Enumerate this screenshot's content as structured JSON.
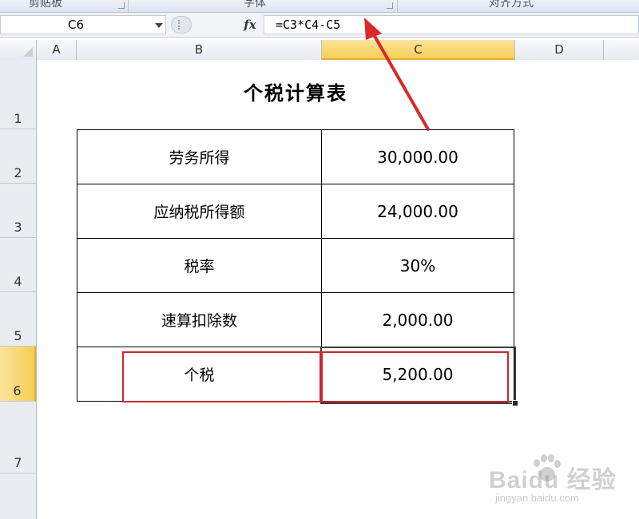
{
  "ribbon": {
    "groups": [
      "剪贴板",
      "字体",
      "对齐方式"
    ]
  },
  "formula_bar": {
    "name_box": "C6",
    "fx_label": "fx",
    "formula": "=C3*C4-C5"
  },
  "columns": [
    "A",
    "B",
    "C",
    "D"
  ],
  "active_column": "C",
  "rows": [
    "1",
    "2",
    "3",
    "4",
    "5",
    "6",
    "7"
  ],
  "active_row": "6",
  "sheet": {
    "title": "个税计算表",
    "table": [
      {
        "label": "劳务所得",
        "value": "30,000.00"
      },
      {
        "label": "应纳税所得额",
        "value": "24,000.00"
      },
      {
        "label": "税率",
        "value": "30%"
      },
      {
        "label": "速算扣除数",
        "value": "2,000.00"
      },
      {
        "label": "个税",
        "value": "5,200.00"
      }
    ]
  },
  "colors": {
    "highlight": "#c8282e",
    "active_header": "#f6cf55"
  },
  "watermark": {
    "brand": "Baidu 经验",
    "url": "jingyan.baidu.com"
  }
}
